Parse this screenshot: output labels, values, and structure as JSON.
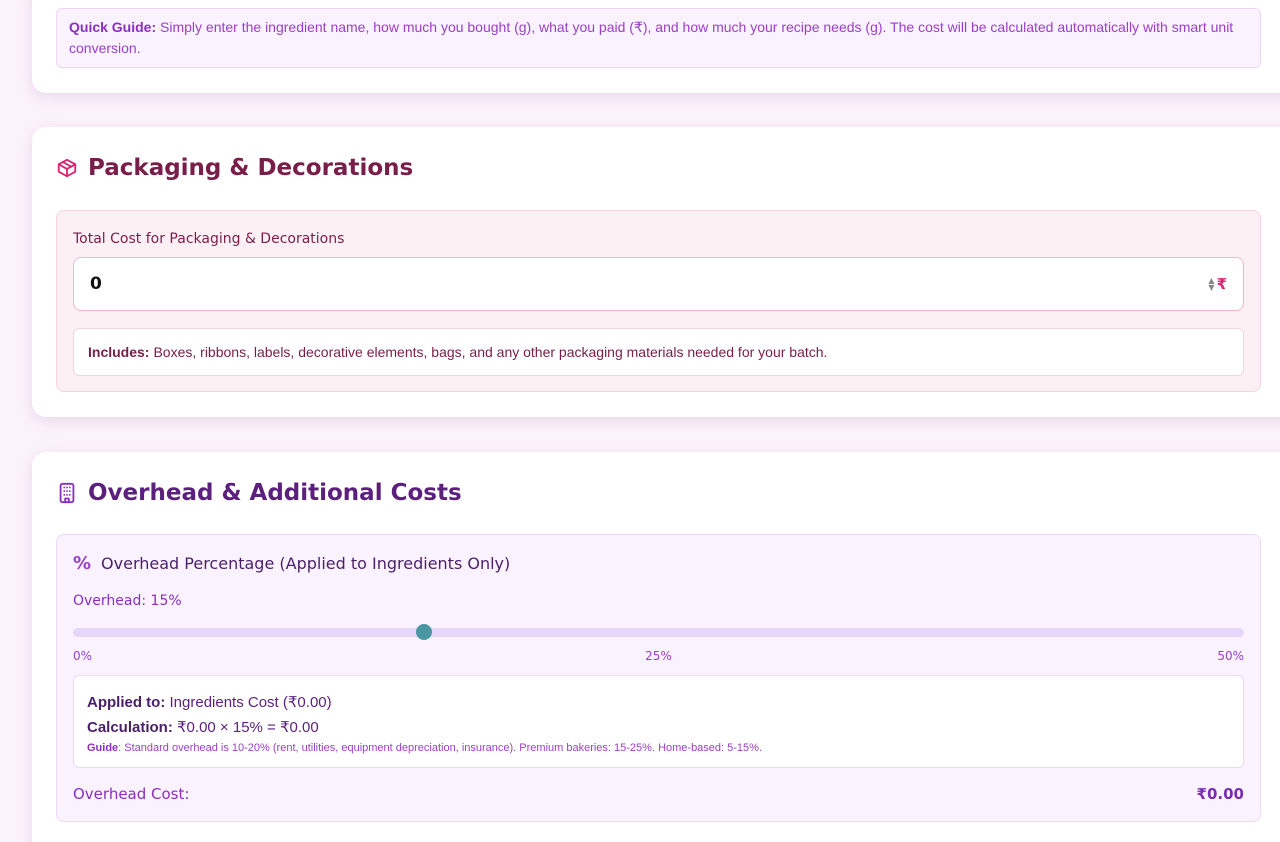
{
  "quick_guide": {
    "label": "Quick Guide:",
    "text": "Simply enter the ingredient name, how much you bought (g), what you paid (₹), and how much your recipe needs (g). The cost will be calculated automatically with smart unit conversion."
  },
  "packaging": {
    "title": "Packaging & Decorations",
    "field_label": "Total Cost for Packaging & Decorations",
    "field_value": "0",
    "currency": "₹",
    "includes_label": "Includes:",
    "includes_text": "Boxes, ribbons, labels, decorative elements, bags, and any other packaging materials needed for your batch."
  },
  "overhead": {
    "title": "Overhead & Additional Costs",
    "heading": "Overhead Percentage (Applied to Ingredients Only)",
    "value_text": "Overhead: 15%",
    "slider": {
      "min": 0,
      "max": 50,
      "value": 15
    },
    "ticks": [
      "0%",
      "25%",
      "50%"
    ],
    "applied_label": "Applied to:",
    "applied_text": "Ingredients Cost (₹0.00)",
    "calc_label": "Calculation:",
    "calc_text": "₹0.00 × 15% = ₹0.00",
    "guide_label": "Guide",
    "guide_text": ": Standard overhead is 10-20% (rent, utilities, equipment depreciation, insurance). Premium bakeries: 15-25%. Home-based: 5-15%.",
    "cost_label": "Overhead Cost:",
    "cost_value": "₹0.00"
  },
  "colors": {
    "packaging_accent": "#7a1d48",
    "overhead_accent": "#5b1f7e",
    "slider_thumb": "#4a97a2",
    "rupee": "#e0206f"
  }
}
